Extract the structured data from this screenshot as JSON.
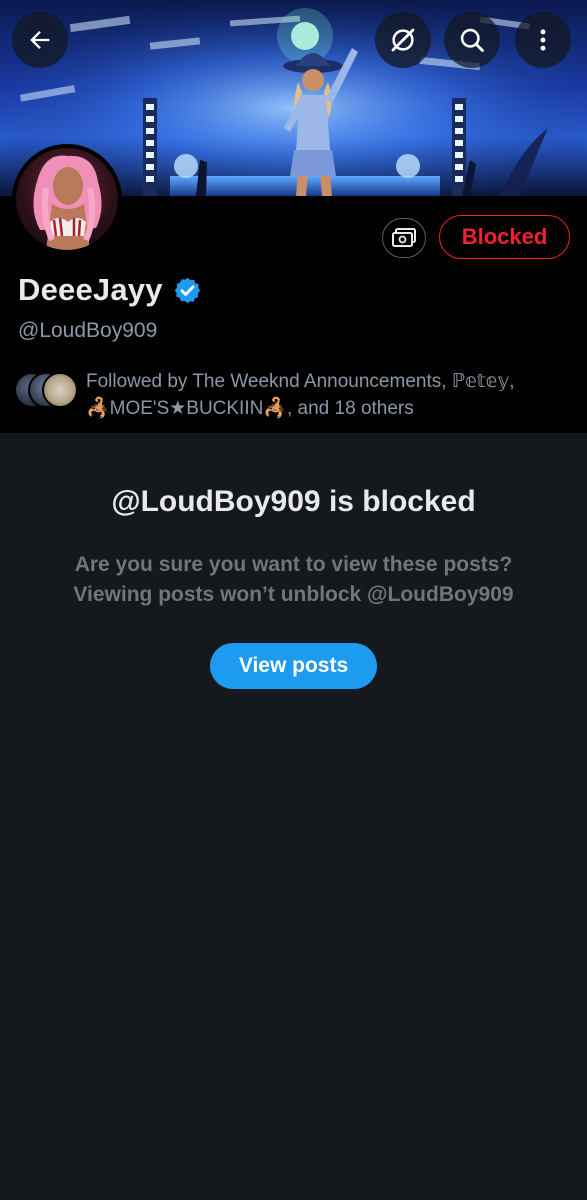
{
  "header": {
    "back_icon": "arrow-left-icon",
    "grok_icon": "grok-icon",
    "search_icon": "search-icon",
    "more_icon": "more-vertical-icon"
  },
  "profile": {
    "display_name": "DeeeJayy",
    "handle": "@LoudBoy909",
    "verified": true,
    "verified_color": "#1d9bf0",
    "blocked_label": "Blocked",
    "blocked_color": "#f4212e",
    "followed_by_line1": "Followed by The Weeknd Announcements, ℙ𝕖𝕥𝕖𝕪,",
    "followed_by_line2": "🦂MOE'S★BUCKIIN🦂, and 18 others"
  },
  "notice": {
    "title": "@LoudBoy909 is blocked",
    "line1": "Are you sure you want to view these posts?",
    "line2": "Viewing posts won’t unblock @LoudBoy909",
    "button_label": "View posts",
    "button_color": "#1d9bf0"
  }
}
